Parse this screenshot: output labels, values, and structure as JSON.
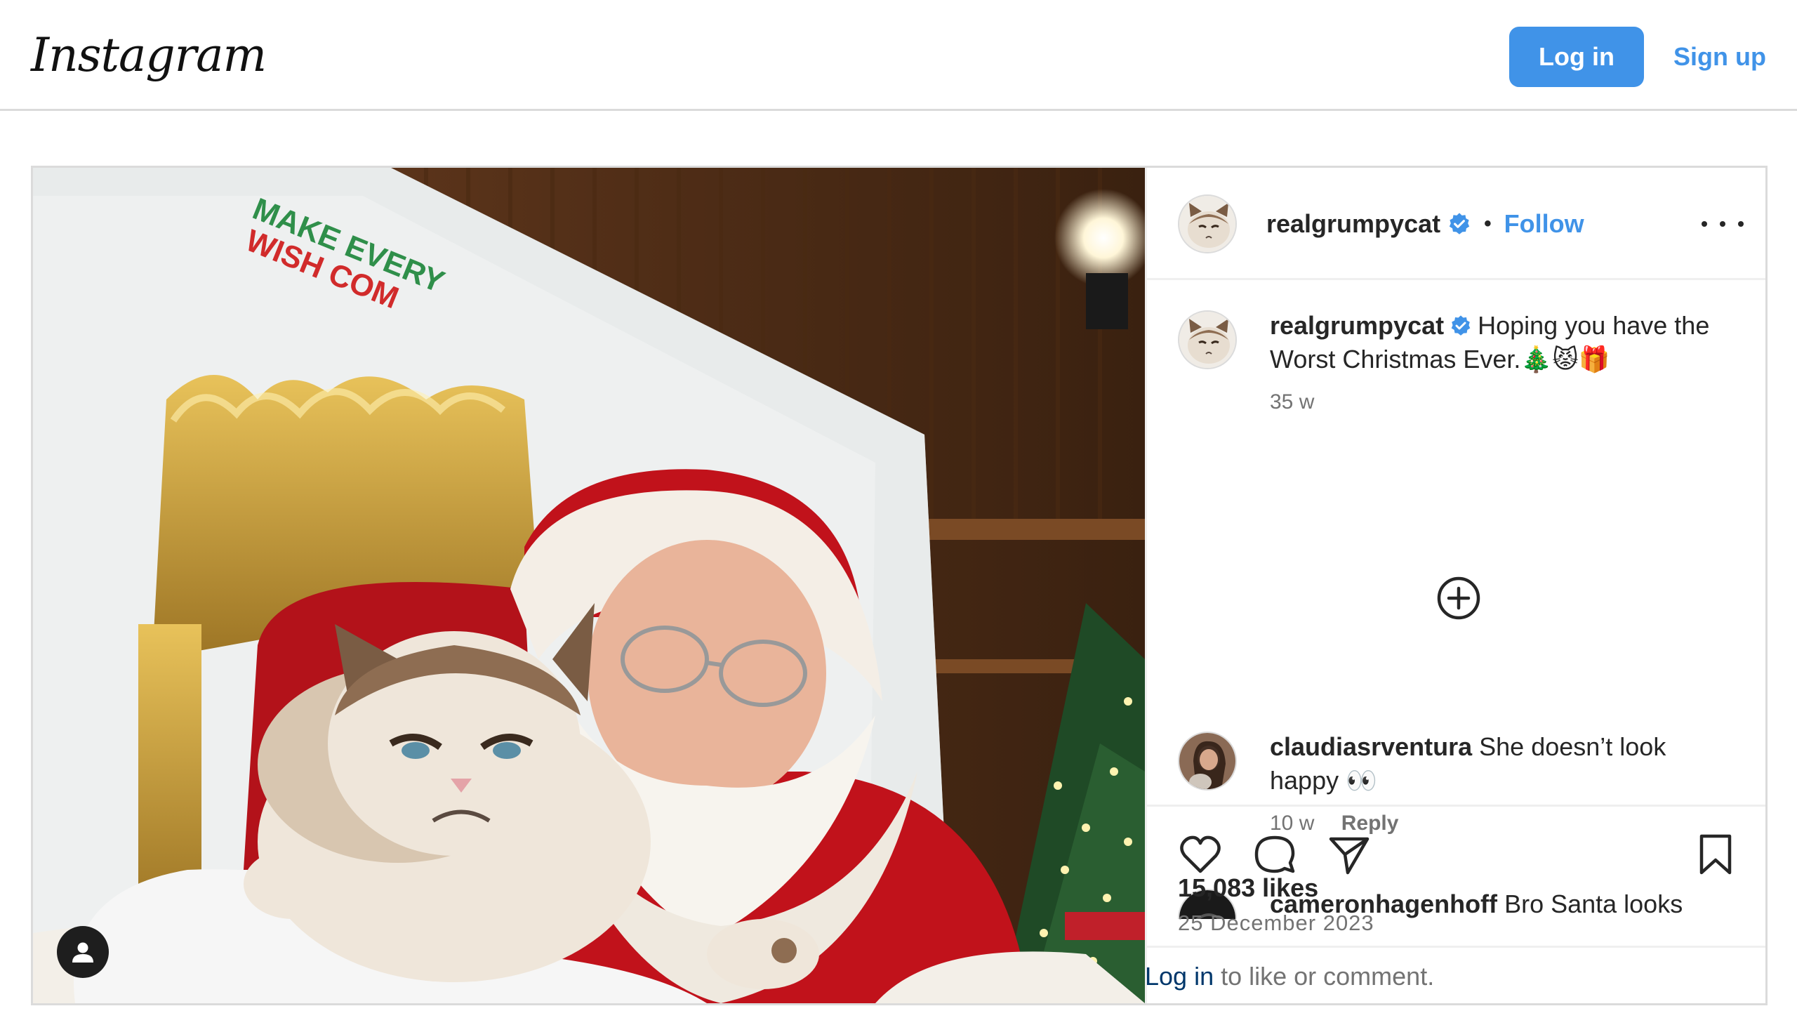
{
  "header": {
    "logo_text": "Instagram",
    "login_label": "Log in",
    "signup_label": "Sign up"
  },
  "colors": {
    "accent": "#4093e8",
    "link_dark": "#00376b",
    "muted_text": "#737373",
    "border": "#dbdbdb"
  },
  "post": {
    "username": "realgrumpycat",
    "follow_label": "Follow",
    "separator": "•",
    "caption": {
      "username": "realgrumpycat",
      "text": "Hoping you have the Worst Christmas Ever.🎄😾🎁",
      "time": "35 w"
    },
    "image": {
      "banner_line1": "MAKE EVERY",
      "banner_line2": "WISH COM"
    },
    "comments": [
      {
        "username": "claudiasrventura",
        "text": "She doesn’t look happy 👀",
        "time": "10 w",
        "reply_label": "Reply"
      },
      {
        "username": "cameronhagenhoff",
        "text": "Bro Santa looks"
      }
    ],
    "likes": "15,083 likes",
    "date": "25 December 2023",
    "login_prompt_link": "Log in",
    "login_prompt_text": " to like or comment."
  },
  "icons": {
    "more": "more-options-icon",
    "verified": "verified-badge-icon",
    "load_more": "plus-circle-icon",
    "like": "heart-icon",
    "comment": "comment-icon",
    "share": "share-icon",
    "save": "bookmark-icon",
    "tag": "user-tag-icon"
  }
}
